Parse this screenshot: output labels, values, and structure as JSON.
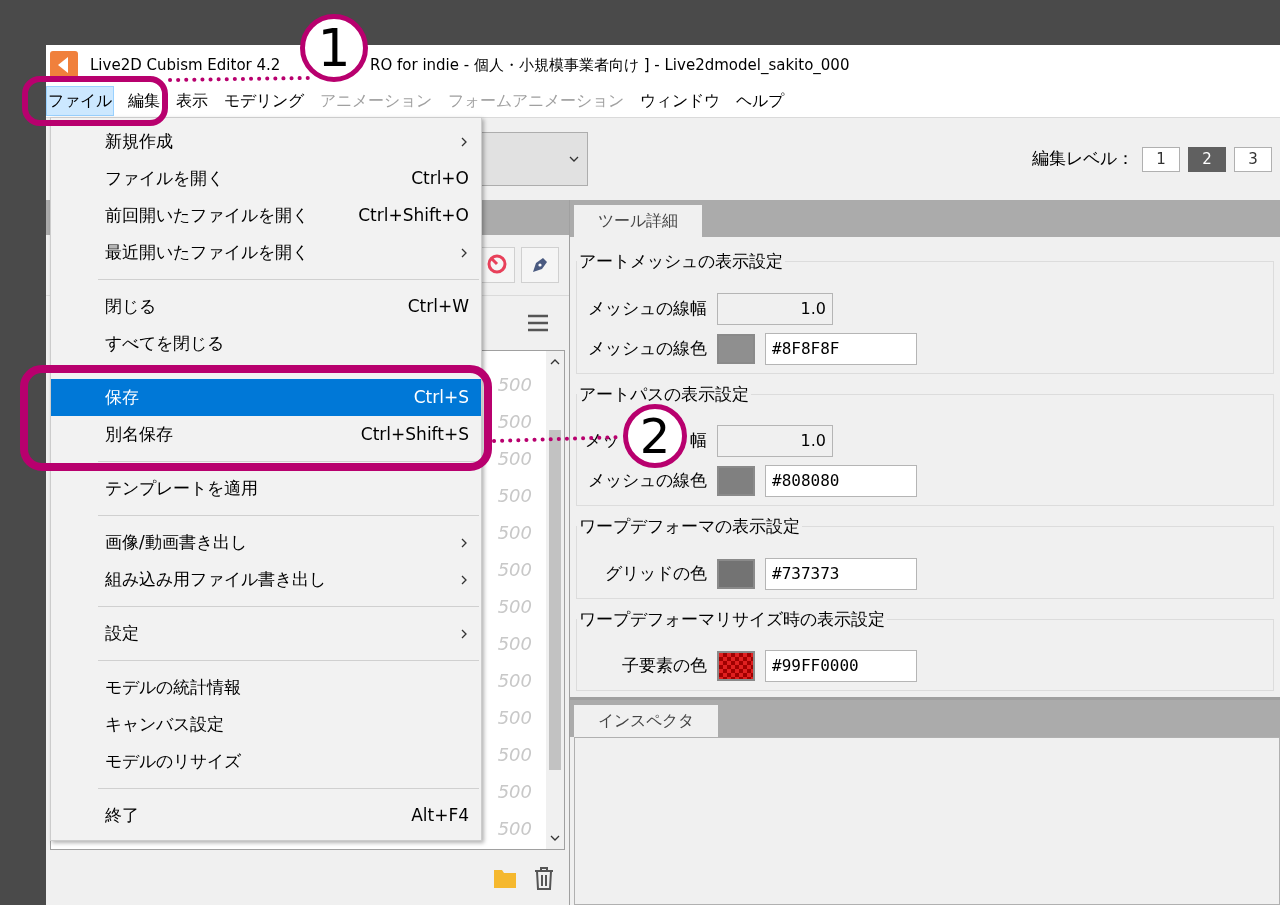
{
  "window": {
    "title_parts": [
      "Live2D Cubism Editor 4.2",
      "RO for indie - 個人・小規模事業者向け ] - Live2dmodel_sakito_000"
    ]
  },
  "menu_bar": [
    {
      "label": "ファイル",
      "selected": true,
      "disabled": false
    },
    {
      "label": "編集",
      "selected": false,
      "disabled": false
    },
    {
      "label": "表示",
      "selected": false,
      "disabled": false
    },
    {
      "label": "モデリング",
      "selected": false,
      "disabled": false
    },
    {
      "label": "アニメーション",
      "selected": false,
      "disabled": true
    },
    {
      "label": "フォームアニメーション",
      "selected": false,
      "disabled": true
    },
    {
      "label": "ウィンドウ",
      "selected": false,
      "disabled": false
    },
    {
      "label": "ヘルプ",
      "selected": false,
      "disabled": false
    }
  ],
  "file_menu": [
    {
      "kind": "item",
      "label": "新規作成",
      "submenu": true,
      "selected": false
    },
    {
      "kind": "item",
      "label": "ファイルを開く",
      "shortcut": "Ctrl+O",
      "submenu": false,
      "selected": false
    },
    {
      "kind": "item",
      "label": "前回開いたファイルを開く",
      "shortcut": "Ctrl+Shift+O",
      "submenu": false,
      "selected": false
    },
    {
      "kind": "item",
      "label": "最近開いたファイルを開く",
      "submenu": true,
      "selected": false
    },
    {
      "kind": "separator"
    },
    {
      "kind": "item",
      "label": "閉じる",
      "shortcut": "Ctrl+W",
      "submenu": false,
      "selected": false
    },
    {
      "kind": "item",
      "label": "すべてを閉じる",
      "submenu": false,
      "selected": false
    },
    {
      "kind": "separator"
    },
    {
      "kind": "item",
      "label": "保存",
      "shortcut": "Ctrl+S",
      "submenu": false,
      "selected": true
    },
    {
      "kind": "item",
      "label": "別名保存",
      "shortcut": "Ctrl+Shift+S",
      "submenu": false,
      "selected": false
    },
    {
      "kind": "separator"
    },
    {
      "kind": "item",
      "label": "テンプレートを適用",
      "submenu": false,
      "selected": false
    },
    {
      "kind": "separator"
    },
    {
      "kind": "item",
      "label": "画像/動画書き出し",
      "submenu": true,
      "selected": false
    },
    {
      "kind": "item",
      "label": "組み込み用ファイル書き出し",
      "submenu": true,
      "selected": false
    },
    {
      "kind": "separator"
    },
    {
      "kind": "item",
      "label": "設定",
      "submenu": true,
      "selected": false
    },
    {
      "kind": "separator"
    },
    {
      "kind": "item",
      "label": "モデルの統計情報",
      "submenu": false,
      "selected": false
    },
    {
      "kind": "item",
      "label": "キャンバス設定",
      "submenu": false,
      "selected": false
    },
    {
      "kind": "item",
      "label": "モデルのリサイズ",
      "submenu": false,
      "selected": false
    },
    {
      "kind": "separator"
    },
    {
      "kind": "item",
      "label": "終了",
      "shortcut": "Alt+F4",
      "submenu": false,
      "selected": false
    }
  ],
  "edit_level": {
    "label": "編集レベル：",
    "levels": [
      {
        "label": "1",
        "selected": false
      },
      {
        "label": "2",
        "selected": true
      },
      {
        "label": "3",
        "selected": false
      }
    ]
  },
  "left_panel": {
    "values": [
      "500",
      "500",
      "500",
      "500",
      "500",
      "500",
      "500",
      "500",
      "500",
      "500",
      "500",
      "500",
      "500"
    ]
  },
  "tool_details": {
    "tab": "ツール詳細",
    "groups": [
      {
        "title": "アートメッシュの表示設定",
        "rows": [
          {
            "kind": "number",
            "label": "メッシュの線幅",
            "value": "1.0"
          },
          {
            "kind": "color",
            "label": "メッシュの線色",
            "color": "#8f8f8f",
            "pattern": false,
            "value": "#8F8F8F"
          }
        ]
      },
      {
        "title": "アートパスの表示設定",
        "rows": [
          {
            "kind": "number",
            "label_parts": [
              "メッ",
              "幅"
            ],
            "value": "1.0"
          },
          {
            "kind": "color",
            "label": "メッシュの線色",
            "color": "#808080",
            "pattern": false,
            "value": "#808080"
          }
        ]
      },
      {
        "title": "ワープデフォーマの表示設定",
        "rows": [
          {
            "kind": "color",
            "label": "グリッドの色",
            "color": "#737373",
            "pattern": false,
            "value": "#737373"
          }
        ]
      },
      {
        "title": "ワープデフォーマリサイズ時の表示設定",
        "rows": [
          {
            "kind": "color",
            "label": "子要素の色",
            "color": "#e02020",
            "pattern": true,
            "value": "#99FF0000"
          }
        ]
      }
    ]
  },
  "inspector": {
    "tab": "インスペクタ"
  },
  "annotations": [
    {
      "number": "1"
    },
    {
      "number": "2"
    }
  ]
}
